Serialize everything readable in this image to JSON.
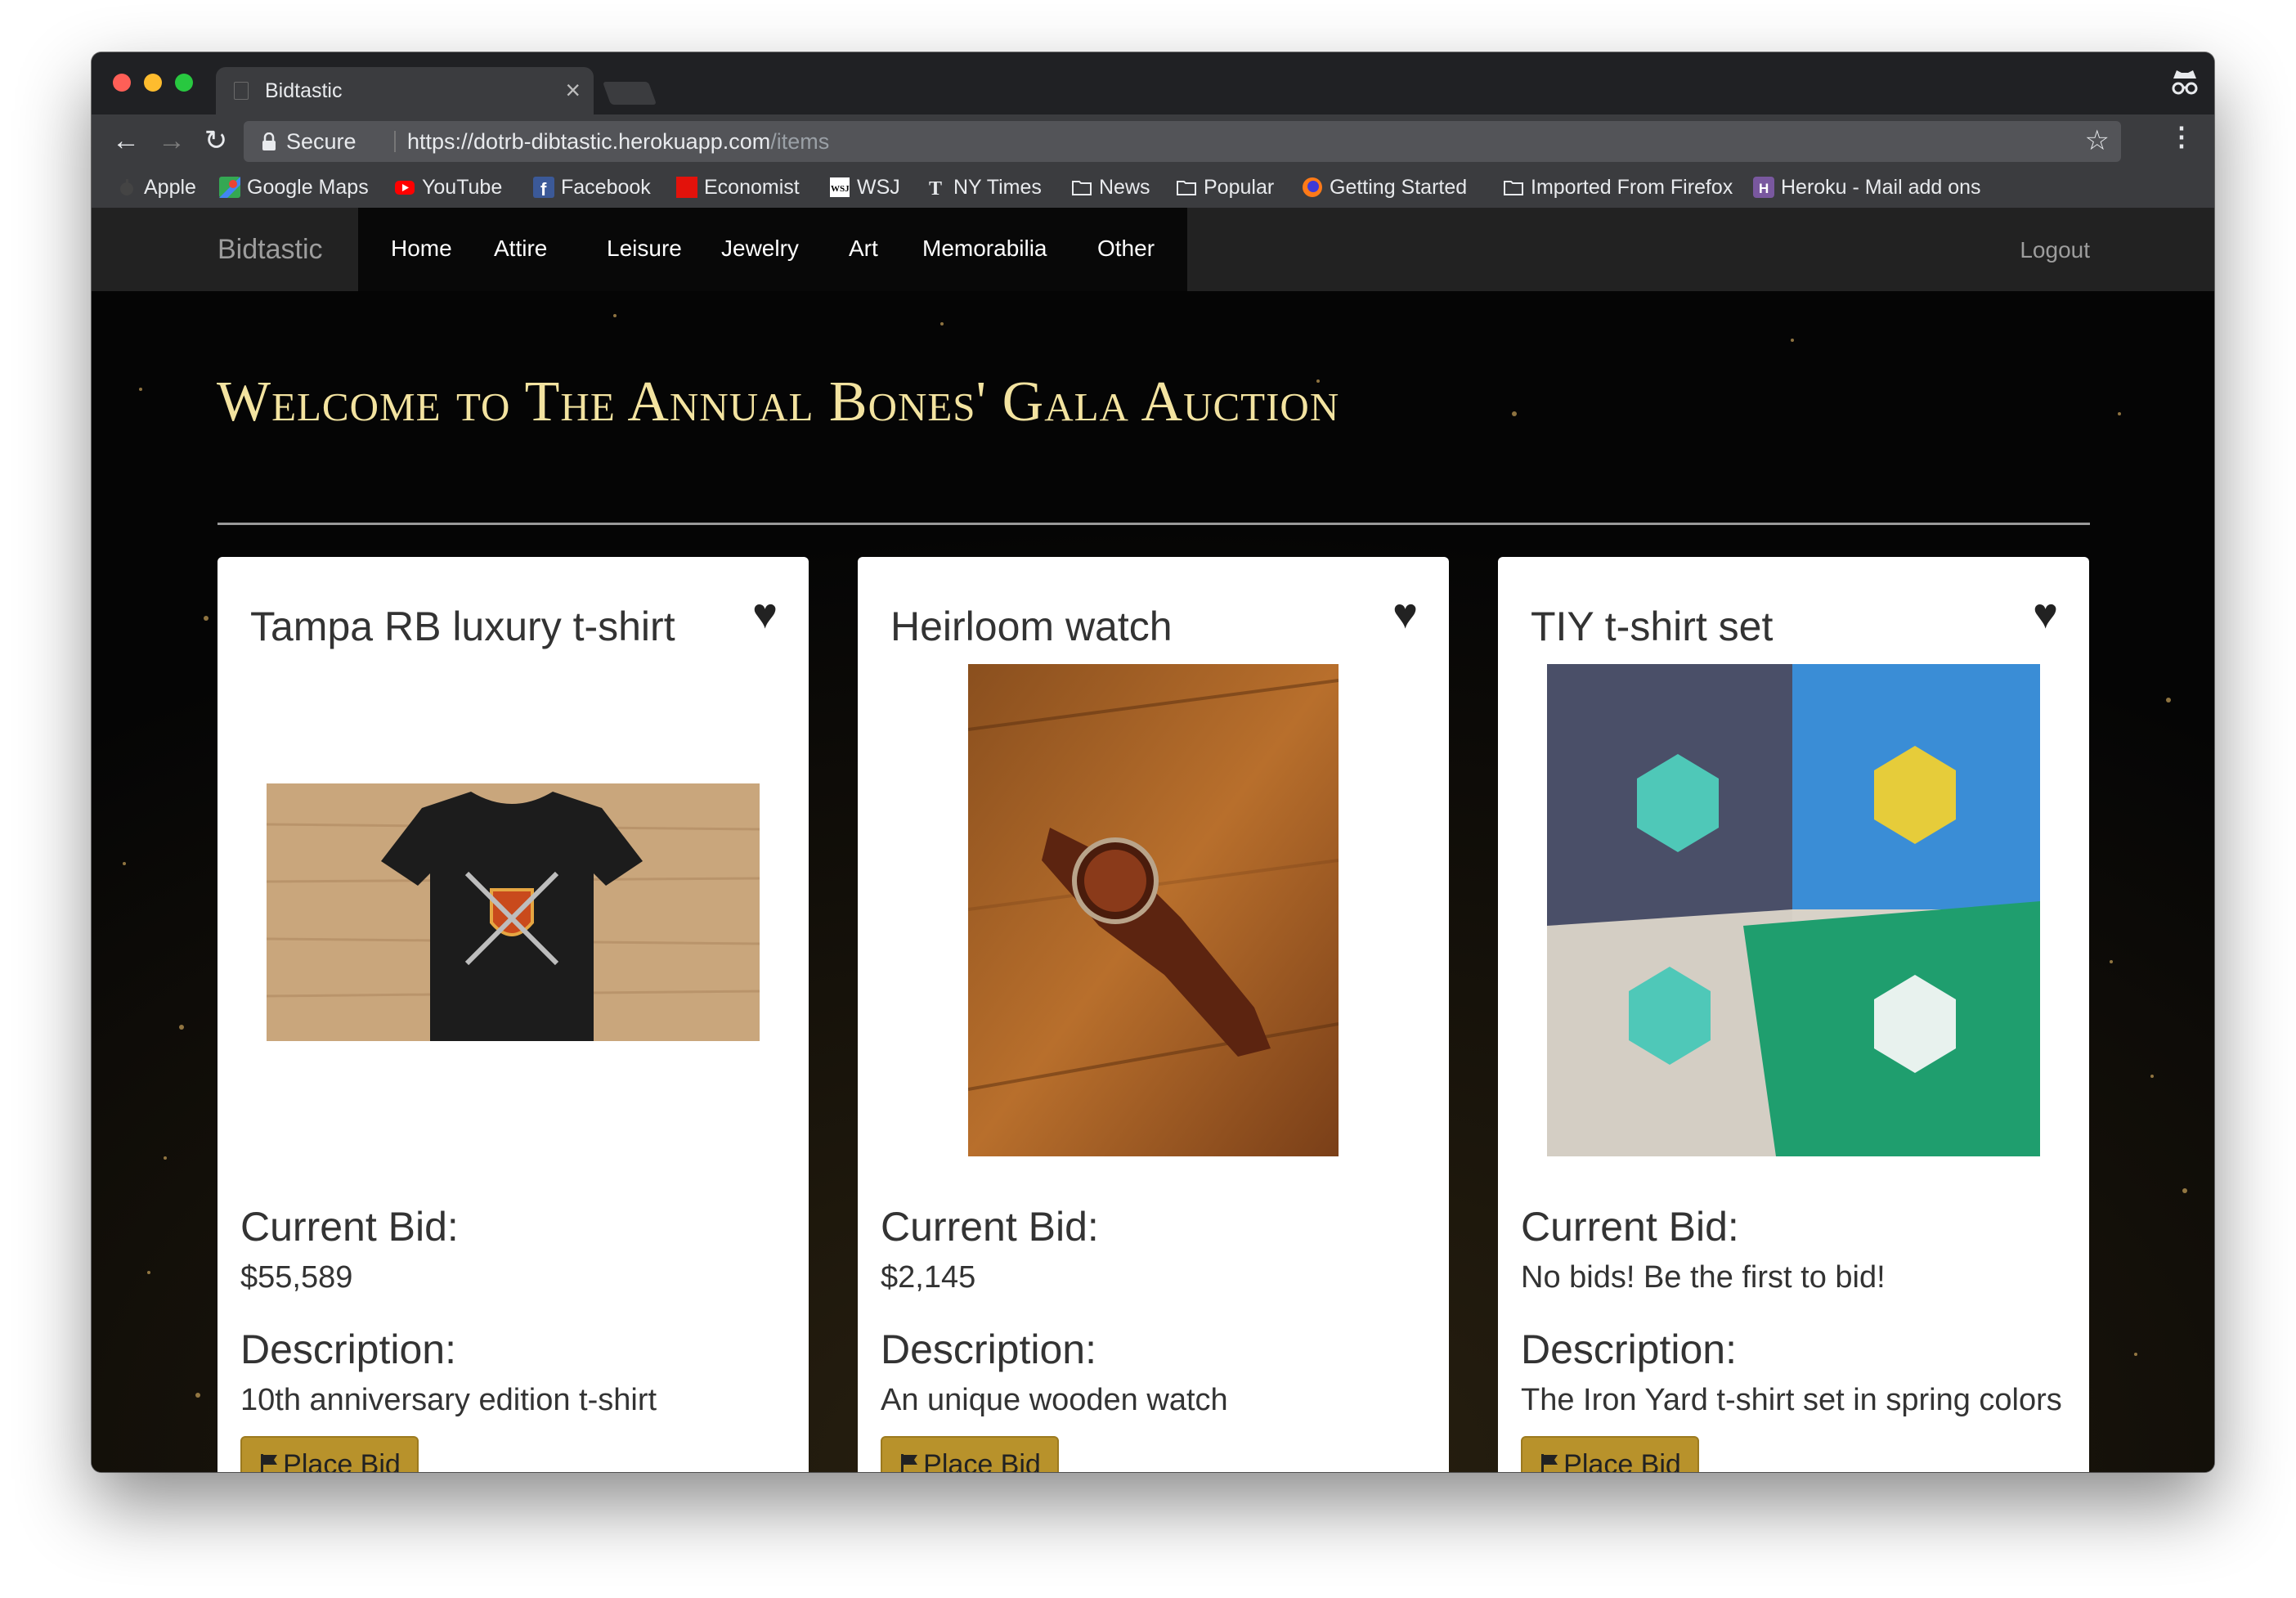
{
  "browser": {
    "tab_title": "Bidtastic",
    "secure_label": "Secure",
    "url_base": "https://dotrb-dibtastic.herokuapp.com",
    "url_path": "/items",
    "bookmarks": [
      {
        "label": "Apple",
        "icon": "apple-icon"
      },
      {
        "label": "Google Maps",
        "icon": "google-maps-icon"
      },
      {
        "label": "YouTube",
        "icon": "youtube-icon"
      },
      {
        "label": "Facebook",
        "icon": "facebook-icon"
      },
      {
        "label": "Economist",
        "icon": "economist-icon"
      },
      {
        "label": "WSJ",
        "icon": "wsj-icon"
      },
      {
        "label": "NY Times",
        "icon": "nytimes-icon"
      },
      {
        "label": "News",
        "icon": "folder-icon"
      },
      {
        "label": "Popular",
        "icon": "folder-icon"
      },
      {
        "label": "Getting Started",
        "icon": "firefox-icon"
      },
      {
        "label": "Imported From Firefox",
        "icon": "folder-icon"
      },
      {
        "label": "Heroku - Mail add ons",
        "icon": "heroku-icon"
      }
    ]
  },
  "site": {
    "brand": "Bidtastic",
    "nav": [
      "Home",
      "Attire",
      "Leisure",
      "Jewelry",
      "Art",
      "Memorabilia",
      "Other"
    ],
    "logout": "Logout",
    "heading": "Welcome to The Annual Bones' Gala Auction"
  },
  "labels": {
    "current_bid": "Current Bid:",
    "description": "Description:",
    "place_bid": "Place Bid"
  },
  "items": [
    {
      "title": "Tampa RB luxury t-shirt",
      "bid": "$55,589",
      "description": "10th anniversary edition t-shirt",
      "image": "black t-shirt with shield logo"
    },
    {
      "title": "Heirloom watch",
      "bid": "$2,145",
      "description": "An unique wooden watch",
      "image": "wooden watch on table"
    },
    {
      "title": "TIY t-shirt set",
      "bid": "No bids! Be the first to bid!",
      "description": "The Iron Yard t-shirt set in spring colors",
      "image": "four Iron Yard t-shirts"
    }
  ],
  "colors": {
    "heading": "#f3e3a0",
    "button": "#b8922b",
    "navbar": "#222222"
  }
}
